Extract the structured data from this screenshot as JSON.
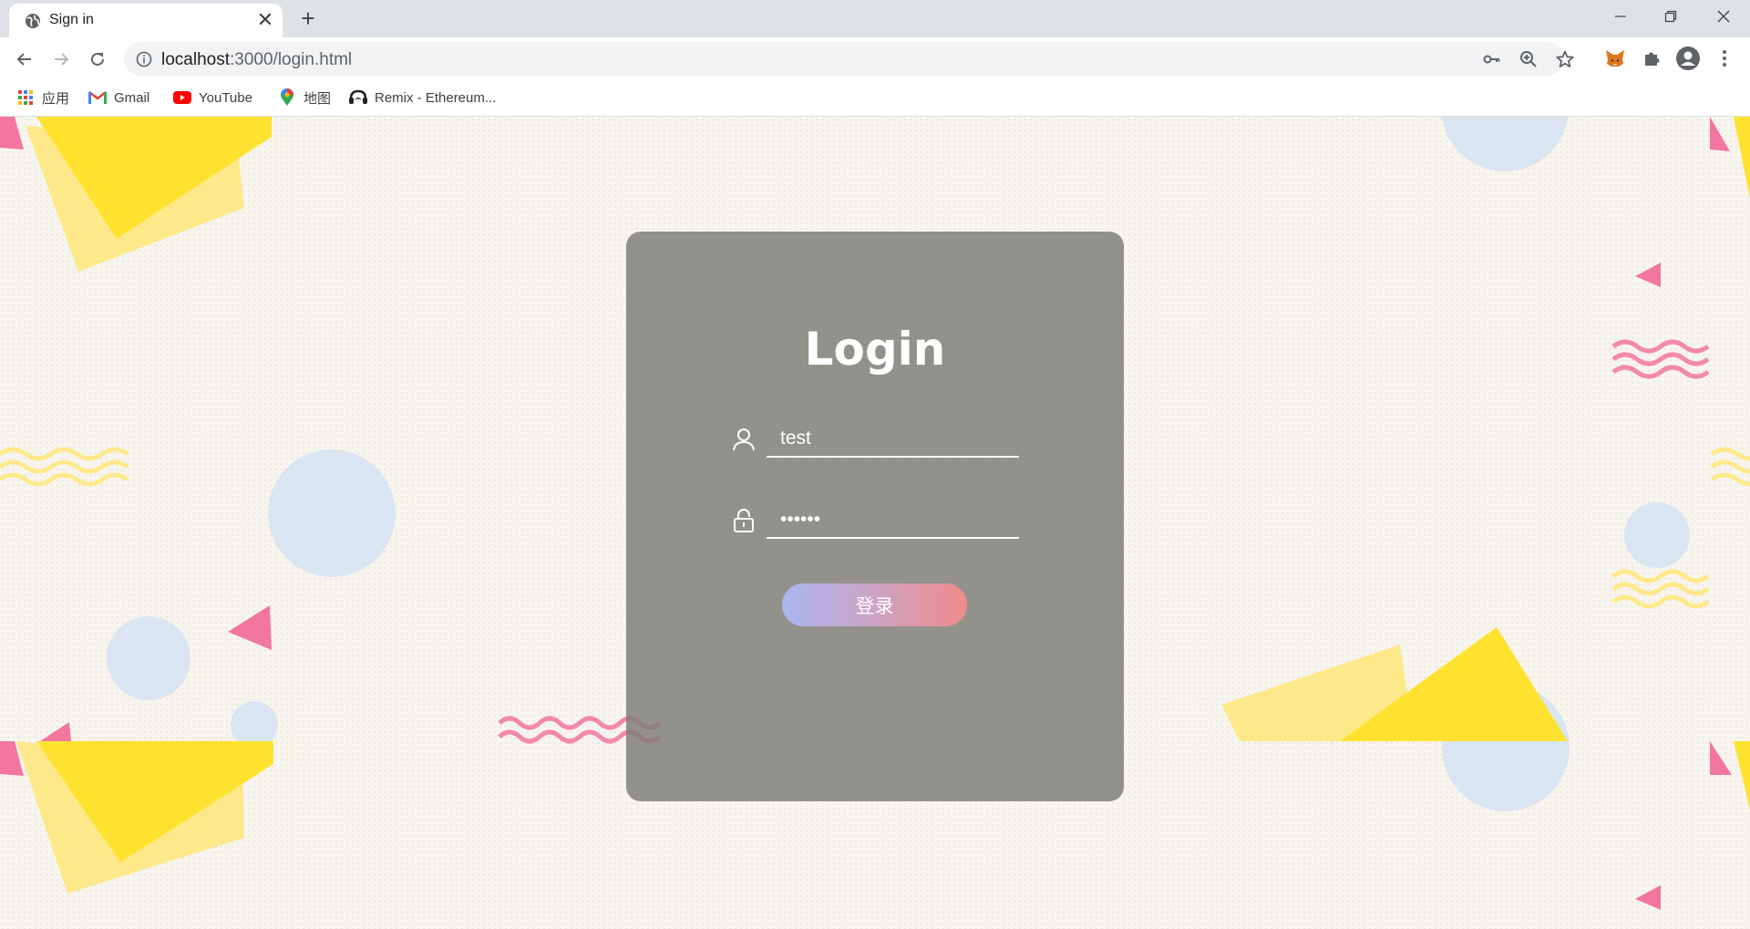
{
  "browser": {
    "tab": {
      "title": "Sign in",
      "close_glyph": "✕",
      "favicon": "globe-icon"
    },
    "new_tab_glyph": "+",
    "window_controls": [
      "minimize-icon",
      "restore-icon",
      "close-icon"
    ],
    "url_host": "localhost",
    "url_rest": ":3000/login.html",
    "omnibox_icons": [
      "key-icon",
      "zoom-icon",
      "star-icon"
    ],
    "extension_icons": [
      "metamask-fox-icon",
      "puzzle-icon",
      "profile-icon",
      "menu-dots-icon"
    ],
    "bookmarks": [
      {
        "label": "应用",
        "icon": "apps-grid-icon"
      },
      {
        "label": "Gmail",
        "icon": "gmail-icon"
      },
      {
        "label": "YouTube",
        "icon": "youtube-icon"
      },
      {
        "label": "地图",
        "icon": "maps-pin-icon"
      },
      {
        "label": "Remix - Ethereum...",
        "icon": "remix-icon"
      }
    ]
  },
  "login": {
    "title": "Login",
    "username_value": "test",
    "password_value": "123456",
    "submit_label": "登录"
  },
  "colors": {
    "background": "#f8f5ef",
    "card": "#7d7b76",
    "yellow": "#ffe22f",
    "light_yellow": "#fde98a",
    "pink": "#f2769f",
    "light_blue": "#d9e5f0",
    "button_gradient_start": "#a9b6f0",
    "button_gradient_end": "#f18a8a"
  }
}
